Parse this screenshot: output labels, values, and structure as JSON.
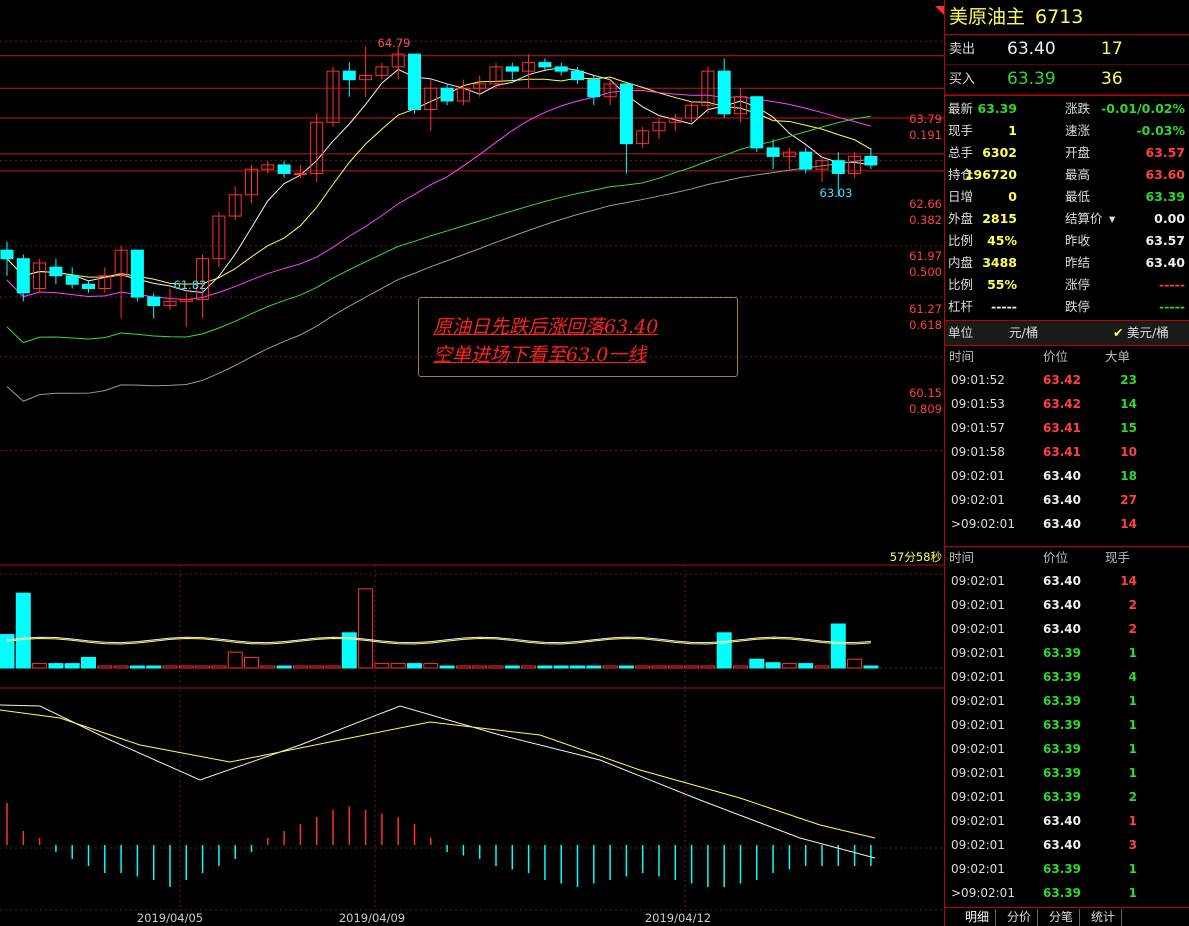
{
  "product": {
    "name": "美原油主",
    "code": "6713"
  },
  "quote": {
    "sell_label": "卖出",
    "sell_price": "63.40",
    "sell_vol": "17",
    "buy_label": "买入",
    "buy_price": "63.39",
    "buy_vol": "36"
  },
  "stats": [
    {
      "l1": "最新",
      "v1": "63.39",
      "c1": "green",
      "l2": "涨跌",
      "v2": "-0.01/0.02%",
      "c2": "green"
    },
    {
      "l1": "现手",
      "v1": "1",
      "c1": "yellow",
      "l2": "速涨",
      "v2": "-0.03%",
      "c2": "green"
    },
    {
      "l1": "总手",
      "v1": "6302",
      "c1": "yellow",
      "l2": "开盘",
      "v2": "63.57",
      "c2": "red"
    },
    {
      "l1": "持仓",
      "v1": "196720",
      "c1": "yellow",
      "l2": "最高",
      "v2": "63.60",
      "c2": "red"
    },
    {
      "l1": "日增",
      "v1": "0",
      "c1": "yellow",
      "l2": "最低",
      "v2": "63.39",
      "c2": "green"
    },
    {
      "l1": "外盘",
      "v1": "2815",
      "c1": "yellow",
      "l2": "结算价",
      "v2": "0.00",
      "c2": "white"
    },
    {
      "l1": "比例",
      "v1": "45%",
      "c1": "yellow",
      "l2": "昨收",
      "v2": "63.57",
      "c2": "white"
    },
    {
      "l1": "内盘",
      "v1": "3488",
      "c1": "yellow",
      "l2": "昨结",
      "v2": "63.40",
      "c2": "white"
    },
    {
      "l1": "比例",
      "v1": "55%",
      "c1": "yellow",
      "l2": "涨停",
      "v2": "-----",
      "c2": "red"
    },
    {
      "l1": "杠杆",
      "v1": "-----",
      "c1": "white",
      "l2": "跌停",
      "v2": "-----",
      "c2": "green"
    }
  ],
  "unit": {
    "label": "单位",
    "opt1": "元/桶",
    "opt2": "美元/桶"
  },
  "big_ticks": {
    "headers": [
      "时间",
      "价位",
      "大单"
    ],
    "rows": [
      {
        "time": "09:01:52",
        "price": "63.42",
        "pc": "red",
        "vol": "23",
        "vc": "green"
      },
      {
        "time": "09:01:53",
        "price": "63.42",
        "pc": "red",
        "vol": "14",
        "vc": "green"
      },
      {
        "time": "09:01:57",
        "price": "63.41",
        "pc": "red",
        "vol": "15",
        "vc": "green"
      },
      {
        "time": "09:01:58",
        "price": "63.41",
        "pc": "red",
        "vol": "10",
        "vc": "red"
      },
      {
        "time": "09:02:01",
        "price": "63.40",
        "pc": "white",
        "vol": "18",
        "vc": "green"
      },
      {
        "time": "09:02:01",
        "price": "63.40",
        "pc": "white",
        "vol": "27",
        "vc": "red"
      },
      {
        "time": ">09:02:01",
        "price": "63.40",
        "pc": "white",
        "vol": "14",
        "vc": "red"
      }
    ]
  },
  "ticks": {
    "headers": [
      "时间",
      "价位",
      "现手"
    ],
    "rows": [
      {
        "time": "09:02:01",
        "price": "63.40",
        "pc": "white",
        "vol": "14",
        "vc": "red"
      },
      {
        "time": "09:02:01",
        "price": "63.40",
        "pc": "white",
        "vol": "2",
        "vc": "red"
      },
      {
        "time": "09:02:01",
        "price": "63.40",
        "pc": "white",
        "vol": "2",
        "vc": "red"
      },
      {
        "time": "09:02:01",
        "price": "63.39",
        "pc": "green",
        "vol": "1",
        "vc": "green"
      },
      {
        "time": "09:02:01",
        "price": "63.39",
        "pc": "green",
        "vol": "4",
        "vc": "green"
      },
      {
        "time": "09:02:01",
        "price": "63.39",
        "pc": "green",
        "vol": "1",
        "vc": "green"
      },
      {
        "time": "09:02:01",
        "price": "63.39",
        "pc": "green",
        "vol": "1",
        "vc": "green"
      },
      {
        "time": "09:02:01",
        "price": "63.39",
        "pc": "green",
        "vol": "1",
        "vc": "green"
      },
      {
        "time": "09:02:01",
        "price": "63.39",
        "pc": "green",
        "vol": "1",
        "vc": "green"
      },
      {
        "time": "09:02:01",
        "price": "63.39",
        "pc": "green",
        "vol": "2",
        "vc": "green"
      },
      {
        "time": "09:02:01",
        "price": "63.40",
        "pc": "white",
        "vol": "1",
        "vc": "red"
      },
      {
        "time": "09:02:01",
        "price": "63.40",
        "pc": "white",
        "vol": "3",
        "vc": "red"
      },
      {
        "time": "09:02:01",
        "price": "63.39",
        "pc": "green",
        "vol": "1",
        "vc": "green"
      },
      {
        "time": ">09:02:01",
        "price": "63.39",
        "pc": "green",
        "vol": "1",
        "vc": "green"
      }
    ]
  },
  "tabs": [
    "明细",
    "分价",
    "分笔",
    "统计"
  ],
  "annotation": {
    "line1": "原油日先跌后涨回落63.40",
    "line2": "空单进场下看至63.0一线"
  },
  "countdown": "57分58秒",
  "fib_labels": [
    {
      "price": "63.79",
      "ratio": "0.191"
    },
    {
      "price": "62.66",
      "ratio": "0.382"
    },
    {
      "price": "61.97",
      "ratio": "0.500"
    },
    {
      "price": "61.27",
      "ratio": "0.618"
    },
    {
      "price": "60.15",
      "ratio": "0.809"
    }
  ],
  "chart_data": {
    "type": "candlestick",
    "price_labels": {
      "high": "64.79",
      "low": "61.82",
      "recent_low": "63.03"
    },
    "date_labels": [
      "2019/04/05",
      "2019/04/09",
      "2019/04/12"
    ],
    "ylim": [
      59.0,
      65.1
    ],
    "candles": [
      {
        "o": 62.4,
        "c": 62.3,
        "h": 62.5,
        "l": 62.1
      },
      {
        "o": 62.3,
        "c": 61.9,
        "h": 62.35,
        "l": 61.8
      },
      {
        "o": 61.95,
        "c": 62.25,
        "h": 62.3,
        "l": 61.9
      },
      {
        "o": 62.2,
        "c": 62.1,
        "h": 62.3,
        "l": 62.0
      },
      {
        "o": 62.1,
        "c": 62.0,
        "h": 62.2,
        "l": 61.95
      },
      {
        "o": 62.0,
        "c": 61.95,
        "h": 62.05,
        "l": 61.9
      },
      {
        "o": 61.95,
        "c": 62.1,
        "h": 62.2,
        "l": 61.9
      },
      {
        "o": 62.1,
        "c": 62.4,
        "h": 62.45,
        "l": 61.6
      },
      {
        "o": 62.4,
        "c": 61.85,
        "h": 62.4,
        "l": 61.8
      },
      {
        "o": 61.85,
        "c": 61.75,
        "h": 61.9,
        "l": 61.6
      },
      {
        "o": 61.75,
        "c": 61.8,
        "h": 61.95,
        "l": 61.7
      },
      {
        "o": 61.8,
        "c": 61.82,
        "h": 61.9,
        "l": 61.5
      },
      {
        "o": 61.82,
        "c": 62.3,
        "h": 62.35,
        "l": 61.6
      },
      {
        "o": 62.3,
        "c": 62.8,
        "h": 62.85,
        "l": 62.2
      },
      {
        "o": 62.8,
        "c": 63.05,
        "h": 63.15,
        "l": 62.75
      },
      {
        "o": 63.05,
        "c": 63.35,
        "h": 63.4,
        "l": 62.95
      },
      {
        "o": 63.35,
        "c": 63.4,
        "h": 63.45,
        "l": 63.3
      },
      {
        "o": 63.4,
        "c": 63.3,
        "h": 63.45,
        "l": 63.25
      },
      {
        "o": 63.3,
        "c": 63.3,
        "h": 63.4,
        "l": 63.25
      },
      {
        "o": 63.3,
        "c": 63.9,
        "h": 64.0,
        "l": 63.2
      },
      {
        "o": 63.9,
        "c": 64.5,
        "h": 64.55,
        "l": 63.85
      },
      {
        "o": 64.5,
        "c": 64.4,
        "h": 64.6,
        "l": 64.2
      },
      {
        "o": 64.4,
        "c": 64.45,
        "h": 64.79,
        "l": 64.2
      },
      {
        "o": 64.45,
        "c": 64.55,
        "h": 64.6,
        "l": 64.4
      },
      {
        "o": 64.55,
        "c": 64.7,
        "h": 64.79,
        "l": 64.4
      },
      {
        "o": 64.7,
        "c": 64.05,
        "h": 64.7,
        "l": 64.0
      },
      {
        "o": 64.05,
        "c": 64.3,
        "h": 64.4,
        "l": 63.8
      },
      {
        "o": 64.3,
        "c": 64.15,
        "h": 64.35,
        "l": 64.1
      },
      {
        "o": 64.15,
        "c": 64.3,
        "h": 64.4,
        "l": 64.1
      },
      {
        "o": 64.3,
        "c": 64.35,
        "h": 64.45,
        "l": 64.2
      },
      {
        "o": 64.35,
        "c": 64.55,
        "h": 64.6,
        "l": 64.3
      },
      {
        "o": 64.55,
        "c": 64.5,
        "h": 64.6,
        "l": 64.4
      },
      {
        "o": 64.5,
        "c": 64.6,
        "h": 64.7,
        "l": 64.3
      },
      {
        "o": 64.6,
        "c": 64.55,
        "h": 64.65,
        "l": 64.5
      },
      {
        "o": 64.55,
        "c": 64.5,
        "h": 64.6,
        "l": 64.45
      },
      {
        "o": 64.5,
        "c": 64.4,
        "h": 64.55,
        "l": 64.35
      },
      {
        "o": 64.4,
        "c": 64.2,
        "h": 64.45,
        "l": 64.1
      },
      {
        "o": 64.2,
        "c": 64.35,
        "h": 64.4,
        "l": 64.1
      },
      {
        "o": 64.35,
        "c": 63.65,
        "h": 64.35,
        "l": 63.3
      },
      {
        "o": 63.65,
        "c": 63.8,
        "h": 63.85,
        "l": 63.6
      },
      {
        "o": 63.8,
        "c": 63.9,
        "h": 63.95,
        "l": 63.7
      },
      {
        "o": 63.9,
        "c": 63.95,
        "h": 64.0,
        "l": 63.8
      },
      {
        "o": 63.95,
        "c": 64.1,
        "h": 64.15,
        "l": 63.9
      },
      {
        "o": 64.1,
        "c": 64.5,
        "h": 64.55,
        "l": 64.0
      },
      {
        "o": 64.5,
        "c": 64.0,
        "h": 64.65,
        "l": 63.95
      },
      {
        "o": 64.0,
        "c": 64.2,
        "h": 64.3,
        "l": 63.9
      },
      {
        "o": 64.2,
        "c": 63.6,
        "h": 64.2,
        "l": 63.55
      },
      {
        "o": 63.6,
        "c": 63.5,
        "h": 63.7,
        "l": 63.35
      },
      {
        "o": 63.5,
        "c": 63.55,
        "h": 63.6,
        "l": 63.35
      },
      {
        "o": 63.55,
        "c": 63.35,
        "h": 63.6,
        "l": 63.3
      },
      {
        "o": 63.35,
        "c": 63.45,
        "h": 63.5,
        "l": 63.2
      },
      {
        "o": 63.45,
        "c": 63.3,
        "h": 63.55,
        "l": 63.03
      },
      {
        "o": 63.3,
        "c": 63.5,
        "h": 63.55,
        "l": 63.25
      },
      {
        "o": 63.5,
        "c": 63.4,
        "h": 63.6,
        "l": 63.35
      }
    ],
    "volumes": [
      0.38,
      0.85,
      0.05,
      0.05,
      0.05,
      0.12,
      0.02,
      0.02,
      0.02,
      0.02,
      0.02,
      0.02,
      0.02,
      0.02,
      0.18,
      0.12,
      0.02,
      0.02,
      0.02,
      0.02,
      0.02,
      0.4,
      0.9,
      0.05,
      0.05,
      0.05,
      0.05,
      0.02,
      0.02,
      0.02,
      0.02,
      0.02,
      0.02,
      0.02,
      0.02,
      0.02,
      0.02,
      0.02,
      0.02,
      0.02,
      0.02,
      0.02,
      0.02,
      0.02,
      0.4,
      0.02,
      0.1,
      0.06,
      0.05,
      0.05,
      0.02,
      0.5,
      0.1,
      0.02
    ],
    "macd_hist": [
      0.6,
      0.2,
      0.1,
      -0.1,
      -0.2,
      -0.3,
      -0.4,
      -0.4,
      -0.45,
      -0.5,
      -0.6,
      -0.5,
      -0.4,
      -0.3,
      -0.2,
      -0.1,
      0.1,
      0.2,
      0.3,
      0.4,
      0.5,
      0.55,
      0.5,
      0.45,
      0.4,
      0.3,
      0.1,
      -0.1,
      -0.15,
      -0.2,
      -0.3,
      -0.35,
      -0.4,
      -0.5,
      -0.55,
      -0.6,
      -0.55,
      -0.5,
      -0.45,
      -0.4,
      -0.45,
      -0.5,
      -0.55,
      -0.6,
      -0.6,
      -0.55,
      -0.5,
      -0.4,
      -0.35,
      -0.3,
      -0.3,
      -0.3,
      -0.3,
      -0.3
    ]
  }
}
